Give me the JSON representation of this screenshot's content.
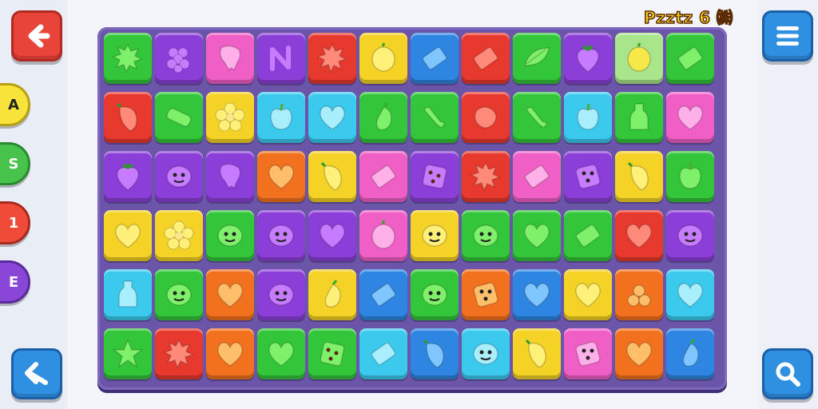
{
  "header": {
    "level_title": "Pzztz 6 ㈱"
  },
  "side_tabs": [
    {
      "label": "A"
    },
    {
      "label": "S"
    },
    {
      "label": "1"
    },
    {
      "label": "E"
    }
  ],
  "colors": {
    "green": "#34c63a",
    "purple": "#8c3fd8",
    "pink": "#f05fc6",
    "red": "#e8392e",
    "yellow": "#f4d226",
    "blue": "#2f86e2",
    "cyan": "#3bc9ee",
    "orange": "#f2711e",
    "lightgreen": "#a9e58a",
    "white": "#ffffff"
  },
  "board": {
    "tiles": [
      [
        "green:splat-icon",
        "purple:berry-icon",
        "pink:tooth-icon",
        "purple:letter-icon",
        "red:splat-icon",
        "yellow:lemon-icon",
        "blue:block-icon",
        "red:block-icon",
        "green:leaf-icon",
        "purple:strawberry-icon",
        "lightgreen:lemon-icon",
        "green:block-icon"
      ],
      [
        "red:pepper-icon",
        "green:bandage-icon",
        "yellow:flower-icon",
        "cyan:apple-icon",
        "cyan:heart-icon",
        "green:eggplant-icon",
        "green:bone-icon",
        "red:blob-icon",
        "green:bone-icon",
        "cyan:apple-icon",
        "green:bottle-icon",
        "pink:heart-icon"
      ],
      [
        "purple:strawberry-icon",
        "purple:face-icon",
        "purple:tooth-icon",
        "orange:heart-icon",
        "yellow:pepper-icon",
        "pink:block-icon",
        "purple:cookie-icon",
        "red:splat-icon",
        "pink:block-icon",
        "purple:dice-icon",
        "yellow:pepper-icon",
        "green:apple-icon"
      ],
      [
        "yellow:heart-icon",
        "yellow:flower-icon",
        "green:face-icon",
        "purple:face-icon",
        "purple:heart-icon",
        "pink:lemon-icon",
        "yellow:face-icon",
        "green:face-icon",
        "green:heart-icon",
        "green:block-icon",
        "red:heart-icon",
        "purple:face-icon"
      ],
      [
        "cyan:bottle-icon",
        "green:face-icon",
        "orange:heart-icon",
        "purple:face-icon",
        "yellow:eggplant-icon",
        "blue:block-icon",
        "green:face-icon",
        "orange:dice-icon",
        "blue:heart-icon",
        "yellow:heart-icon",
        "orange:cherry-icon",
        "cyan:heart-icon"
      ],
      [
        "green:star-icon",
        "red:splat-icon",
        "orange:heart-icon",
        "green:heart-icon",
        "green:cookie-icon",
        "cyan:block-icon",
        "blue:pepper-icon",
        "cyan:face-icon",
        "yellow:pepper-icon",
        "pink:dice-icon",
        "orange:heart-icon",
        "blue:eggplant-icon"
      ]
    ]
  }
}
